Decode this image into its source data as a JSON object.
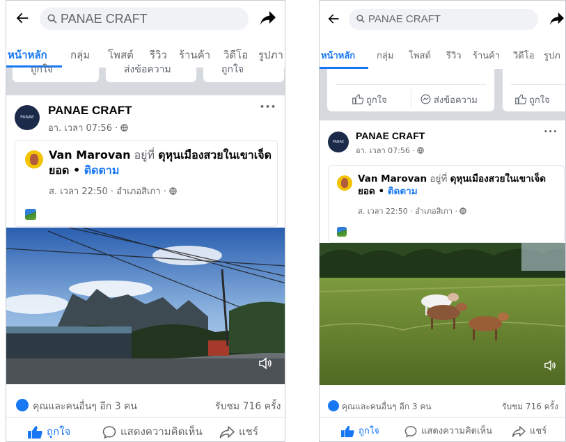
{
  "colors": {
    "accent": "#1877f2",
    "text_primary": "#050505",
    "text_secondary": "#65676b",
    "page_avatar": "#1c2a4a",
    "divider_band": "#d6d9de"
  },
  "icons": {
    "back": "back-arrow-icon",
    "search": "search-icon",
    "share_top": "share-arrow-icon",
    "more": "more-dots-icon",
    "globe": "globe-icon",
    "photo": "photo-icon",
    "sound": "speaker-icon",
    "like": "thumbs-up-icon",
    "comment": "comment-bubble-icon",
    "share": "share-icon"
  },
  "left": {
    "header": {
      "search_text": "PANAE CRAFT"
    },
    "tabs": [
      "หน้าหลัก",
      "กลุ่ม",
      "โพสต์",
      "รีวิว",
      "ร้านค้า",
      "วิดีโอ",
      "รูปภา"
    ],
    "strip_buttons": [
      "ถูกใจ",
      "ส่งข้อความ",
      "ถูกใจ"
    ],
    "post": {
      "page_avatar_text": "PANAE",
      "page_name": "PANAE CRAFT",
      "time": "อา. เวลา 07:56 · ",
      "more": "•••",
      "shared": {
        "user_name": "Van Marovan",
        "at_word": " อยู่ที่ ",
        "place_line1": "ดุหุนเมืองสวยในเขาเจ็ด",
        "place_line2": "ยอด",
        "dot": " • ",
        "follow": "ติดตาม",
        "meta": "ส. เวลา 22:50 · อำเภอสิเกา · "
      },
      "reaction_text": "คุณและคนอื่นๆ อีก 3 คน",
      "views_text": "รับชม 716 ครั้ง",
      "actions": {
        "like": "ถูกใจ",
        "comment": "แสดงความคิดเห็น",
        "share": "แชร์"
      }
    }
  },
  "right": {
    "header": {
      "search_text": "PANAE CRAFT"
    },
    "tabs": [
      "หน้าหลัก",
      "กลุ่ม",
      "โพสต์",
      "รีวิว",
      "ร้านค้า",
      "วิดีโอ",
      "รูปภ"
    ],
    "strip_buttons": [
      "ถูกใจ",
      "ส่งข้อความ",
      "ถูกใจ"
    ],
    "post": {
      "page_avatar_text": "PANAE",
      "page_name": "PANAE CRAFT",
      "time": "อา. เวลา 07:56 · ",
      "more": "•••",
      "shared": {
        "user_name": "Van Marovan",
        "at_word": " อยู่ที่ ",
        "place_line1": "ดุหุนเมืองสวยในเขาเจ็ด",
        "place_line2": "ยอด",
        "dot": " • ",
        "follow": "ติดตาม",
        "meta": "ส. เวลา 22:50 · อำเภอสิเกา · "
      },
      "reaction_text": "คุณและคนอื่นๆ อีก 3 คน",
      "views_text": "รับชม 716 ครั้ง",
      "actions": {
        "like": "ถูกใจ",
        "comment": "แสดงความคิดเห็น",
        "share": "แชร์"
      }
    }
  }
}
